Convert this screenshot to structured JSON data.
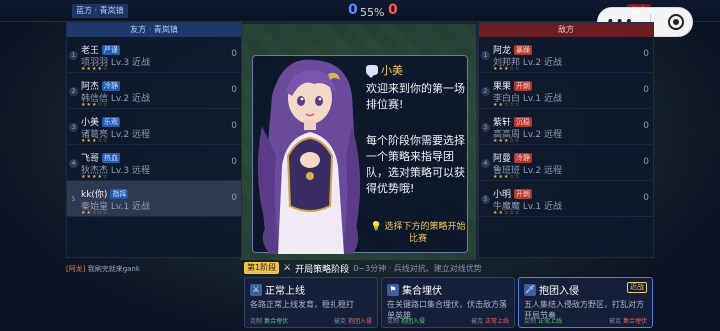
{
  "top": {
    "left_team": "蓝方 · 青岚镇",
    "right_team": "红方",
    "blue_score": "0",
    "percent": "55%",
    "red_score": "0"
  },
  "left_panel": {
    "header": "友方 · 青岚镇",
    "rows": [
      {
        "num": "1",
        "name": "老王",
        "tag": "严谨",
        "hero": "项羽羽 Lv.3  近战",
        "val": "0"
      },
      {
        "num": "2",
        "name": "阿杰",
        "tag": "冷静",
        "hero": "韩信信 Lv.2  近战",
        "val": "0"
      },
      {
        "num": "3",
        "name": "小美",
        "tag": "乐观",
        "hero": "诸葛亮 Lv.2  远程",
        "val": "0"
      },
      {
        "num": "4",
        "name": "飞哥",
        "tag": "热血",
        "hero": "狄杰杰 Lv.3  远程",
        "val": "0"
      },
      {
        "num": "5",
        "name": "kk(你)",
        "tag": "指挥",
        "hero": "秦始皇 Lv.1  近战",
        "val": "0"
      }
    ]
  },
  "right_panel": {
    "header": "敌方",
    "rows": [
      {
        "num": "1",
        "name": "阿龙",
        "tag": "暴躁",
        "hero": "刘邦邦 Lv.2  近战",
        "val": "0"
      },
      {
        "num": "2",
        "name": "果果",
        "tag": "开朗",
        "hero": "李白白 Lv.1  近战",
        "val": "0"
      },
      {
        "num": "3",
        "name": "紫轩",
        "tag": "沉稳",
        "hero": "高高周 Lv.2  远程",
        "val": "0"
      },
      {
        "num": "4",
        "name": "阿曼",
        "tag": "冷静",
        "hero": "鲁班班 Lv.2  远程",
        "val": "0"
      },
      {
        "num": "5",
        "name": "小明",
        "tag": "开朗",
        "hero": "牛魔魔 Lv.1  近战",
        "val": "0"
      }
    ]
  },
  "dialog": {
    "speaker": "小美",
    "msg1": "欢迎来到你的第一场排位赛!",
    "msg2": "每个阶段你需要选择一个策略来指导团队，选对策略可以获得优势哦!",
    "hint": "选择下方的策略开始比赛"
  },
  "stage": {
    "badge": "第1阶段",
    "title": "开局策略阶段",
    "desc": "0~3分钟 · 兵线对抗、建立对线优势"
  },
  "chat": {
    "who": "[阿龙]",
    "text": "我刷完就来gank"
  },
  "cards": [
    {
      "title": "正常上线",
      "body": "各路正常上线发育，稳扎稳打",
      "counter": "克制",
      "counter_v": "集合埋伏",
      "weak": "被克",
      "weak_v": "抱团入侵",
      "type": ""
    },
    {
      "title": "集合埋伏",
      "body": "在关键路口集合埋伏，伏击敌方落单英雄",
      "counter": "克制",
      "counter_v": "抱团入侵",
      "weak": "被克",
      "weak_v": "正常上线",
      "type": ""
    },
    {
      "title": "抱团入侵",
      "body": "五人集结入侵敌方野区，打乱对方开局节奏",
      "counter": "克制",
      "counter_v": "正常上线",
      "weak": "被克",
      "weak_v": "集合埋伏",
      "type": "近战"
    }
  ],
  "colors": {
    "blue": "#5b8bff",
    "red": "#ff5656",
    "gold": "#f1c85a"
  }
}
